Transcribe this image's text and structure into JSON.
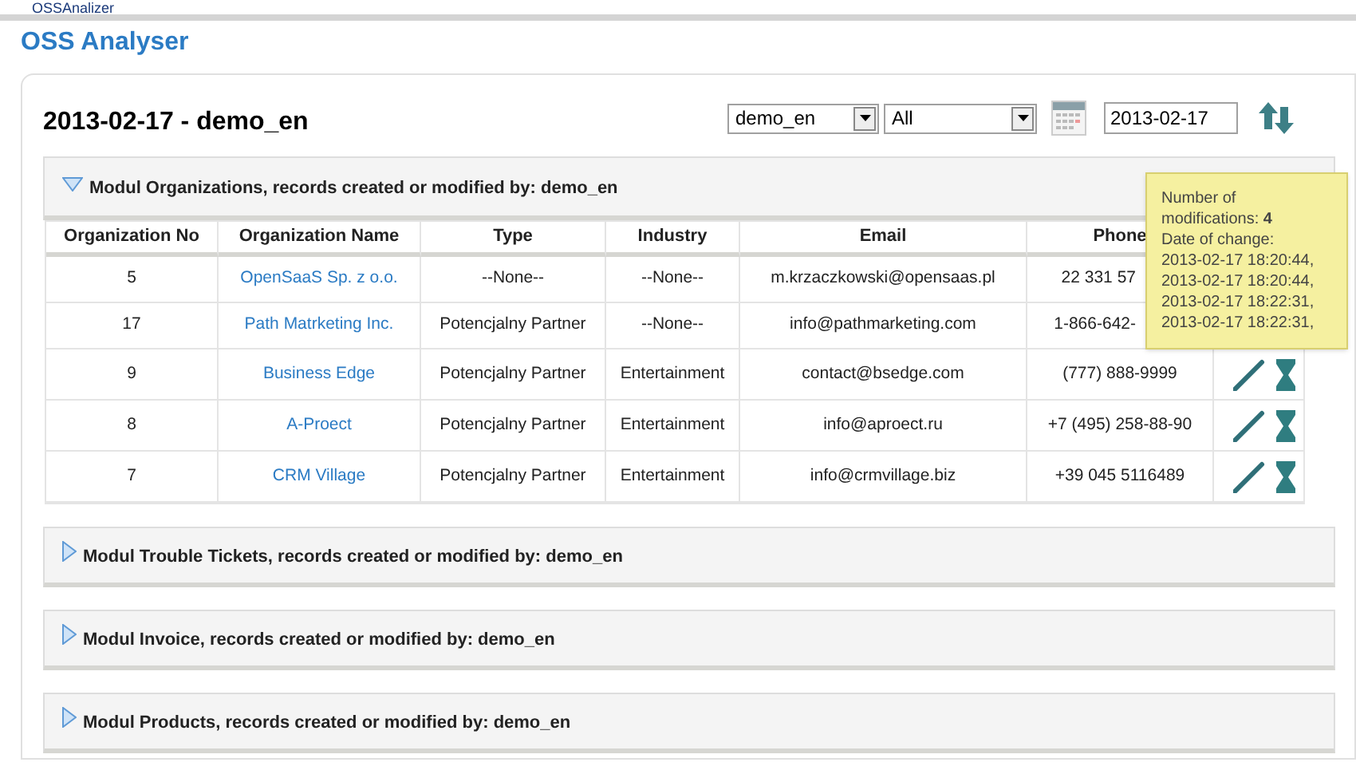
{
  "top_tab": {
    "label": "OSSAnalizer"
  },
  "app_title": "OSS Analyser",
  "report": {
    "title": "2013-02-17 - demo_en",
    "user_select": {
      "value": "demo_en"
    },
    "module_select": {
      "value": "All"
    },
    "date_field": {
      "value": "2013-02-17"
    }
  },
  "modules": [
    {
      "title": "Modul Organizations, records created or modified by: demo_en",
      "expanded": true,
      "table": {
        "columns": [
          "Organization No",
          "Organization Name",
          "Type",
          "Industry",
          "Email",
          "Phone"
        ],
        "rows": [
          {
            "cells": [
              "5",
              "OpenSaaS Sp. z o.o.",
              "--None--",
              "--None--",
              "m.krzaczkowski@opensaas.pl",
              "22 331 57"
            ]
          },
          {
            "cells": [
              "17",
              "Path Matrketing Inc.",
              "Potencjalny Partner",
              "--None--",
              "info@pathmarketing.com",
              "1-866-642-"
            ]
          },
          {
            "cells": [
              "9",
              "Business Edge",
              "Potencjalny Partner",
              "Entertainment",
              "contact@bsedge.com",
              "(777) 888-9999"
            ],
            "actions": true
          },
          {
            "cells": [
              "8",
              "A-Proect",
              "Potencjalny Partner",
              "Entertainment",
              "info@aproect.ru",
              "+7 (495) 258-88-90"
            ],
            "actions": true
          },
          {
            "cells": [
              "7",
              "CRM Village",
              "Potencjalny Partner",
              "Entertainment",
              "info@crmvillage.biz",
              "+39 045 5116489"
            ],
            "actions": true
          }
        ]
      }
    },
    {
      "title": "Modul Trouble Tickets, records created or modified by: demo_en",
      "expanded": false
    },
    {
      "title": "Modul Invoice, records created or modified by: demo_en",
      "expanded": false
    },
    {
      "title": "Modul Products, records created or modified by: demo_en",
      "expanded": false
    }
  ],
  "tooltip": {
    "count_line": "Number of modifications: **4**",
    "date_label": "Date of change:",
    "dates": [
      "2013-02-17 18:20:44,",
      "2013-02-17 18:20:44,",
      "2013-02-17 18:22:31,",
      "2013-02-17 18:22:31,"
    ]
  }
}
